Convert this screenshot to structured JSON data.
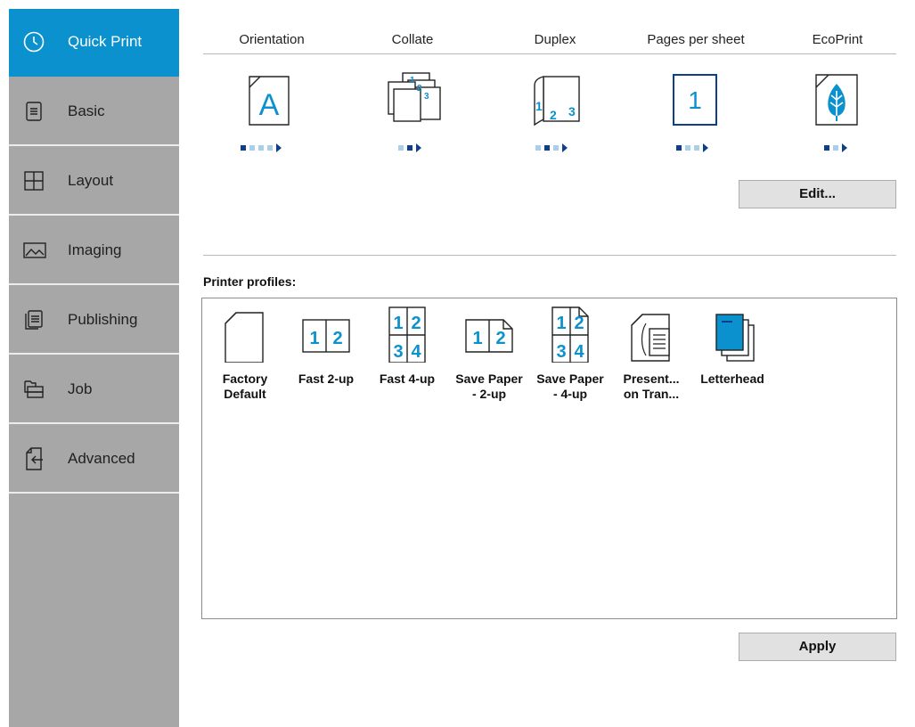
{
  "sidebar": {
    "items": [
      {
        "label": "Quick Print",
        "icon": "clock-icon",
        "active": true
      },
      {
        "label": "Basic",
        "icon": "document-icon",
        "active": false
      },
      {
        "label": "Layout",
        "icon": "grid-layout-icon",
        "active": false
      },
      {
        "label": "Imaging",
        "icon": "image-icon",
        "active": false
      },
      {
        "label": "Publishing",
        "icon": "publishing-icon",
        "active": false
      },
      {
        "label": "Job",
        "icon": "job-stack-icon",
        "active": false
      },
      {
        "label": "Advanced",
        "icon": "advanced-arrow-icon",
        "active": false
      }
    ]
  },
  "quick_settings": {
    "headers": [
      "Orientation",
      "Collate",
      "Duplex",
      "Pages per sheet",
      "EcoPrint"
    ],
    "orientation_glyph": "A",
    "pages_per_sheet_glyph": "1",
    "collate_glyphs": [
      "1",
      "2",
      "3"
    ],
    "duplex_glyphs": [
      "1",
      "2",
      "3"
    ],
    "indicators": [
      {
        "count": 4,
        "selected": 0
      },
      {
        "count": 2,
        "selected": 1
      },
      {
        "count": 3,
        "selected": 1
      },
      {
        "count": 3,
        "selected": 0
      },
      {
        "count": 2,
        "selected": 0
      }
    ]
  },
  "buttons": {
    "edit": "Edit...",
    "apply": "Apply"
  },
  "profiles": {
    "label": "Printer profiles:",
    "items": [
      {
        "label": "Factory\nDefault",
        "icon": "blank-page-icon"
      },
      {
        "label": "Fast 2-up",
        "icon": "two-up-icon",
        "glyphs": [
          "1",
          "2"
        ]
      },
      {
        "label": "Fast 4-up",
        "icon": "four-up-icon",
        "glyphs": [
          "1",
          "2",
          "3",
          "4"
        ]
      },
      {
        "label": "Save Paper\n- 2-up",
        "icon": "save-paper-two-up-icon",
        "glyphs": [
          "1",
          "2"
        ]
      },
      {
        "label": "Save Paper\n- 4-up",
        "icon": "save-paper-four-up-icon",
        "glyphs": [
          "1",
          "2",
          "3",
          "4"
        ]
      },
      {
        "label": "Present...\non Tran...",
        "icon": "transparency-icon"
      },
      {
        "label": "Letterhead",
        "icon": "letterhead-icon"
      }
    ]
  },
  "colors": {
    "accent": "#0b91cd",
    "sidebar": "#a7a7a7",
    "indicator_selected": "#0d3f8a",
    "indicator": "#a9cfea"
  }
}
